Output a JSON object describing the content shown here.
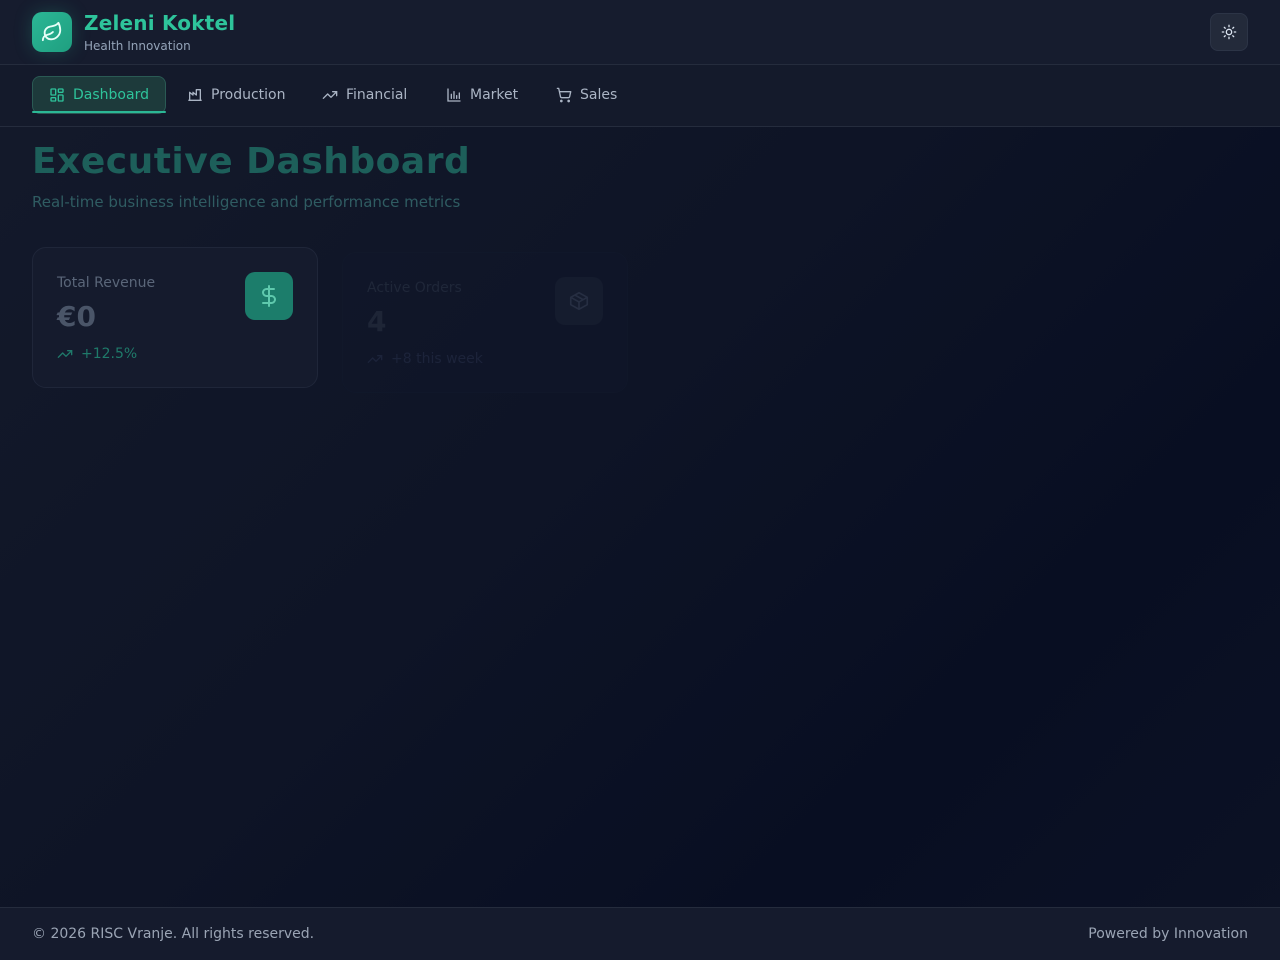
{
  "brand": {
    "title": "Zeleni Koktel",
    "subtitle": "Health Innovation",
    "logo_icon": "leaf-icon",
    "accent_color": "#2ec49b"
  },
  "header": {
    "theme_toggle_icon": "sun-icon"
  },
  "nav": {
    "tabs": [
      {
        "label": "Dashboard",
        "icon": "grid-icon",
        "active": true
      },
      {
        "label": "Production",
        "icon": "factory-icon",
        "active": false
      },
      {
        "label": "Financial",
        "icon": "trending-up-icon",
        "active": false
      },
      {
        "label": "Market",
        "icon": "bar-chart-icon",
        "active": false
      },
      {
        "label": "Sales",
        "icon": "cart-icon",
        "active": false
      }
    ]
  },
  "main": {
    "title": "Executive Dashboard",
    "subtitle": "Real-time business intelligence and performance metrics",
    "cards": [
      {
        "label": "Total Revenue",
        "value": "€0",
        "trend": "+12.5%",
        "icon": "dollar-icon",
        "trend_icon": "trending-up-icon"
      },
      {
        "label": "Active Orders",
        "value": "4",
        "trend": "+8 this week",
        "icon": "package-icon",
        "trend_icon": "trending-up-icon"
      }
    ]
  },
  "footer": {
    "copyright": "© 2026 RISC Vranje. All rights reserved.",
    "powered_by": "Powered by Innovation"
  }
}
